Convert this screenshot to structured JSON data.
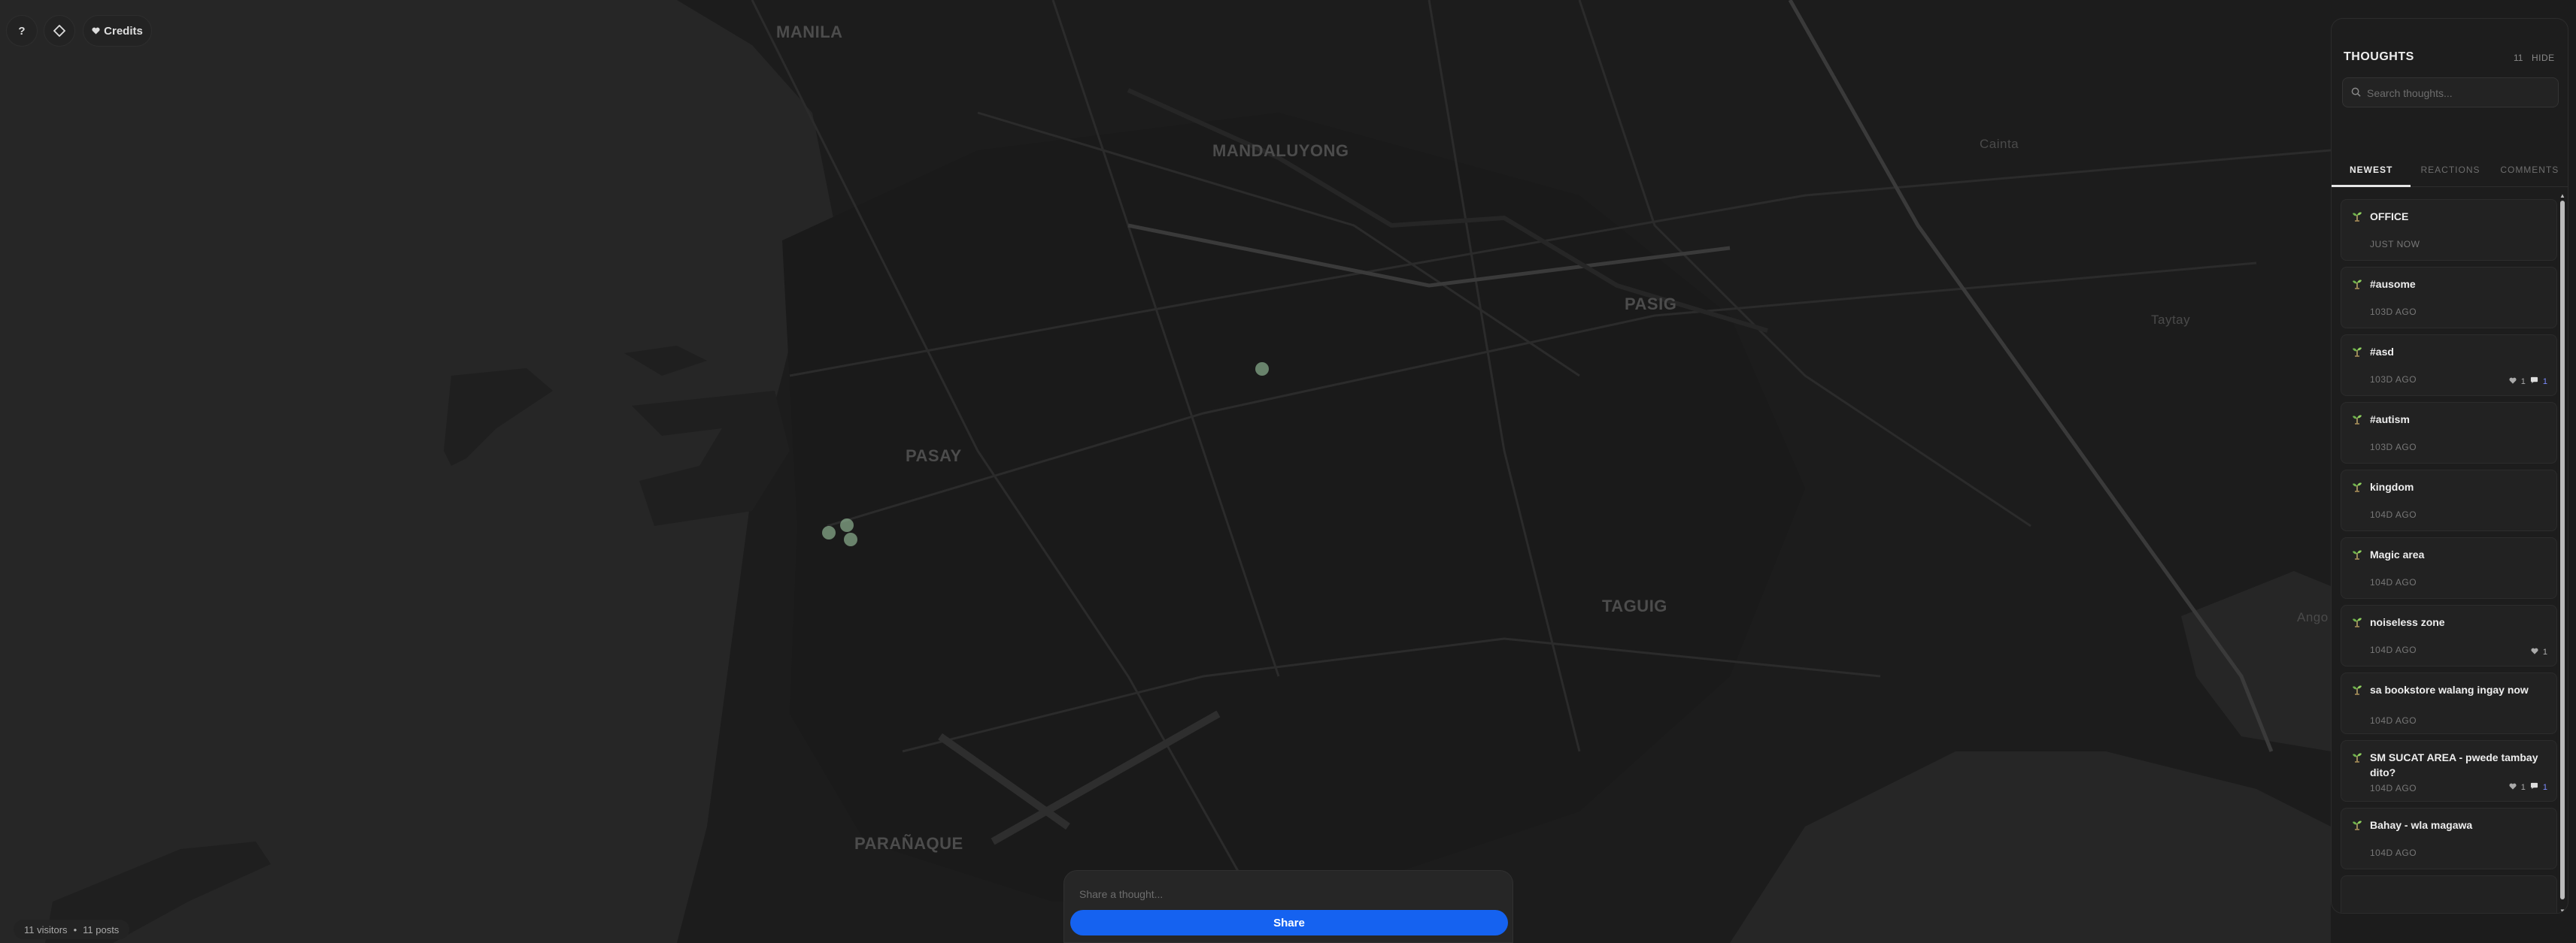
{
  "map": {
    "labels": {
      "manila": "MANILA",
      "mandaluyong": "MANDALUYONG",
      "pasig": "PASIG",
      "pasay": "PASAY",
      "taguig": "TAGUIG",
      "paranaque": "PARAÑAQUE",
      "cainta": "Cainta",
      "taytay": "Taytay",
      "angono": "Ango"
    }
  },
  "controls": {
    "help_label": "?",
    "credits_label": "Credits"
  },
  "stats": {
    "visitors": "11 visitors",
    "separator": "•",
    "posts": "11 posts"
  },
  "composer": {
    "placeholder": "Share a thought...",
    "share_label": "Share"
  },
  "panel": {
    "title": "THOUGHTS",
    "count": "11",
    "hide_label": "HIDE",
    "search_placeholder": "Search thoughts...",
    "tabs": [
      "NEWEST",
      "REACTIONS",
      "COMMENTS"
    ],
    "items": [
      {
        "title": "OFFICE",
        "time": "JUST NOW",
        "hearts": "",
        "comments": ""
      },
      {
        "title": "#ausome",
        "time": "103D AGO",
        "hearts": "",
        "comments": ""
      },
      {
        "title": "#asd",
        "time": "103D AGO",
        "hearts": "1",
        "comments": "1"
      },
      {
        "title": "#autism",
        "time": "103D AGO",
        "hearts": "",
        "comments": ""
      },
      {
        "title": "kingdom",
        "time": "104D AGO",
        "hearts": "",
        "comments": ""
      },
      {
        "title": "Magic area",
        "time": "104D AGO",
        "hearts": "",
        "comments": ""
      },
      {
        "title": "noiseless zone",
        "time": "104D AGO",
        "hearts": "1",
        "comments": ""
      },
      {
        "title": "sa bookstore walang ingay now",
        "time": "104D AGO",
        "hearts": "",
        "comments": ""
      },
      {
        "title": "SM SUCAT AREA - pwede tambay dito?",
        "time": "104D AGO",
        "hearts": "1",
        "comments": "1"
      },
      {
        "title": "Bahay - wla magawa",
        "time": "104D AGO",
        "hearts": "",
        "comments": ""
      }
    ]
  },
  "colors": {
    "accent": "#1562f0",
    "map_bg": "#1c1c1c",
    "water": "#262626",
    "road": "#2a2a2a",
    "pin": "#9fc9a3"
  },
  "icons": {
    "help": "question-mark",
    "locate": "diamond-locate-icon",
    "credits": "heart-icon",
    "search": "search-icon",
    "post": "seedling-icon",
    "heart": "heart-icon",
    "comment": "speech-bubble-icon"
  }
}
